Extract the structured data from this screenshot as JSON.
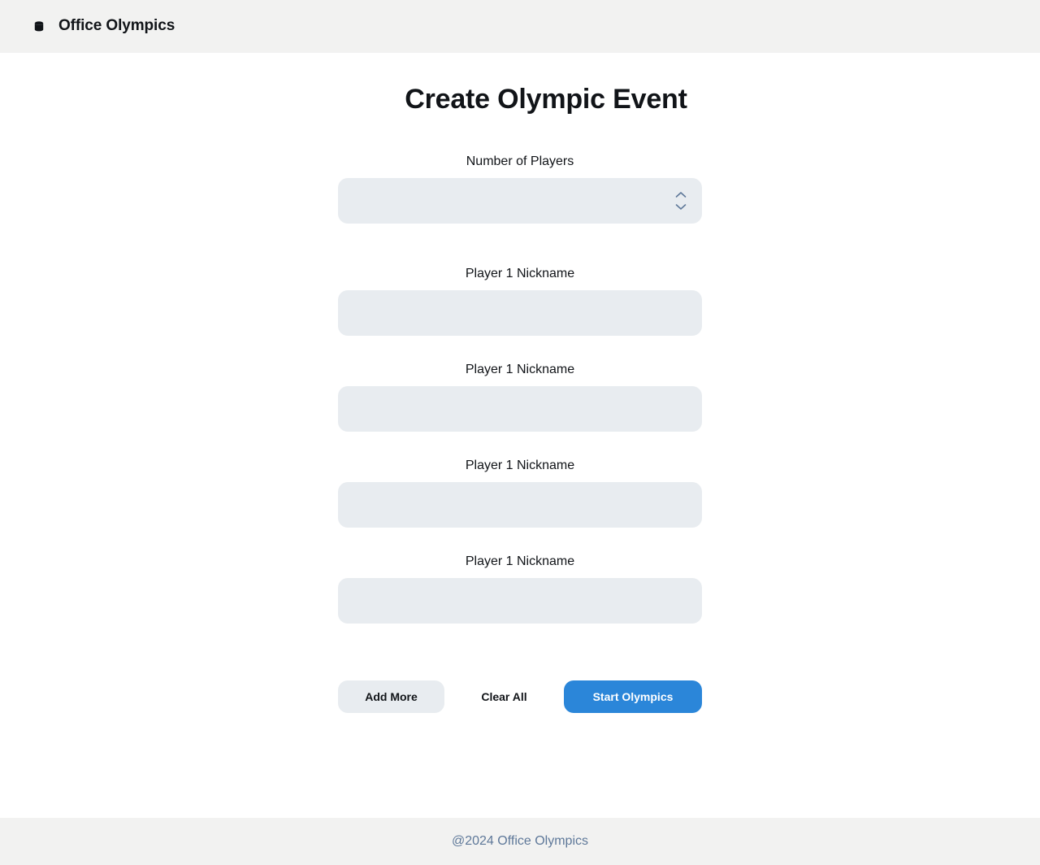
{
  "header": {
    "app_title": "Office Olympics",
    "logo_icon": "database-icon"
  },
  "main": {
    "page_title": "Create Olympic Event",
    "players_field": {
      "label": "Number of Players",
      "value": "",
      "icon": "chevron-up-down-icon"
    },
    "nickname_fields": [
      {
        "label": "Player 1 Nickname",
        "value": ""
      },
      {
        "label": "Player 1 Nickname",
        "value": ""
      },
      {
        "label": "Player 1 Nickname",
        "value": ""
      },
      {
        "label": "Player 1 Nickname",
        "value": ""
      }
    ],
    "buttons": {
      "add_more": "Add More",
      "clear_all": "Clear All",
      "start": "Start Olympics"
    }
  },
  "footer": {
    "text": "@2024 Office Olympics"
  },
  "colors": {
    "header_bg": "#f2f2f1",
    "input_bg": "#e8ecf0",
    "primary": "#2b86d9",
    "footer_text": "#5e7899"
  }
}
